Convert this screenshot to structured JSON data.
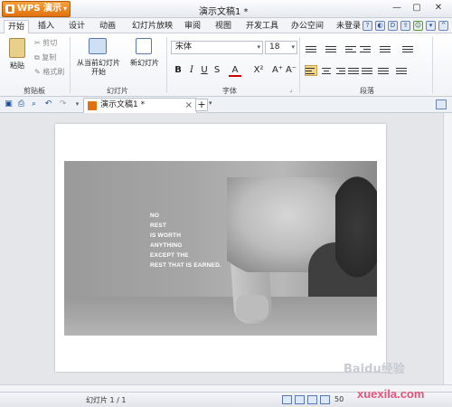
{
  "app": {
    "name": "WPS 演示",
    "doc_title": "演示文稿1 *"
  },
  "tabs": [
    "开始",
    "插入",
    "设计",
    "动画",
    "幻灯片放映",
    "审阅",
    "视图",
    "开发工具",
    "办公空间"
  ],
  "login": "未登录",
  "clipboard": {
    "paste": "粘贴",
    "cut": "剪切",
    "copy": "复制",
    "format_painter": "格式刷",
    "group": "剪贴板"
  },
  "slides": {
    "from_current": "从当前幻灯片",
    "from_current2": "开始",
    "new_slide": "新幻灯片",
    "group": "幻灯片"
  },
  "font": {
    "name": "宋体",
    "size": "18",
    "group": "字体"
  },
  "paragraph": {
    "group": "段落"
  },
  "doc_tab": {
    "label": "演示文稿1 *"
  },
  "slide_quote": [
    "NO",
    "REST",
    "IS WORTH",
    "ANYTHING",
    "EXCEPT THE",
    "REST THAT IS EARNED."
  ],
  "status": {
    "slide_count": "幻灯片 1 / 1",
    "zoom": "50"
  },
  "watermark": {
    "baidu": "Baidu经验",
    "site": "xuexila.com"
  },
  "colors": {
    "accent": "#e07010",
    "ribbon_blue": "#1d4a94",
    "site": "#e8527a"
  }
}
